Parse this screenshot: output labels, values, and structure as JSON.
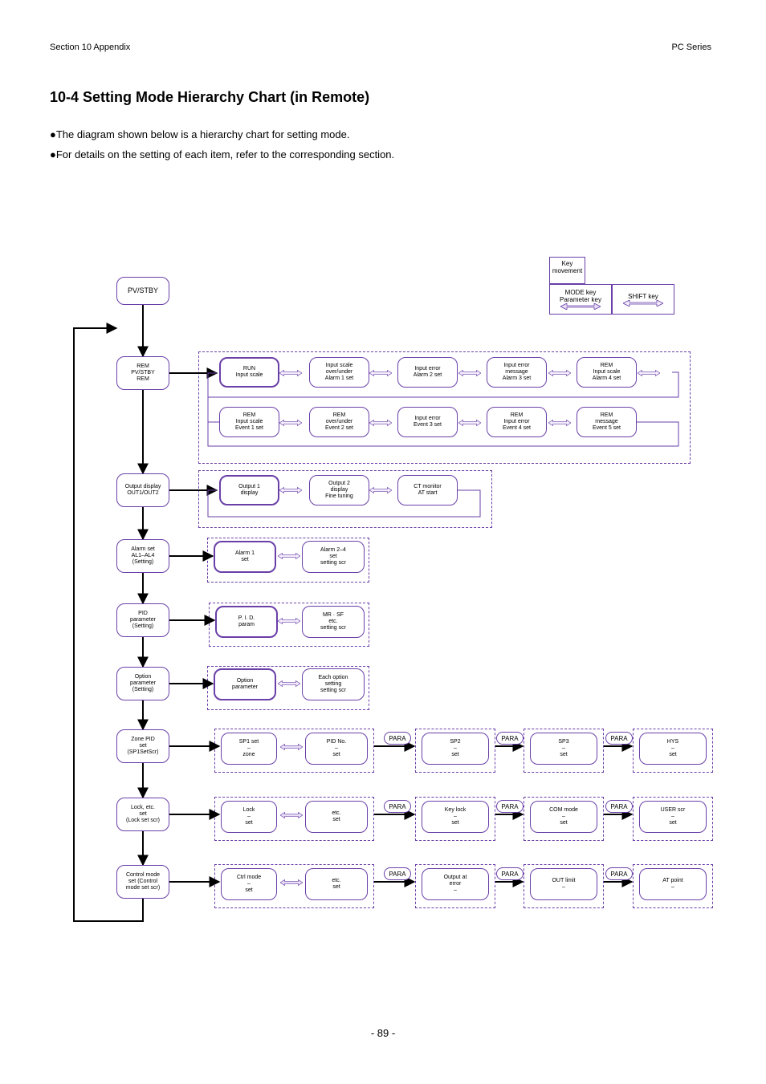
{
  "page_header": {
    "section": "Section 10 Appendix",
    "product": "PC Series"
  },
  "heading": {
    "main": "10-4 Setting Mode Hierarchy Chart (in Remote)",
    "note1": "●The diagram shown below is a hierarchy chart for setting mode.",
    "note2": "●For details on the setting of each item, refer to the corresponding section."
  },
  "footer": "- 89 -",
  "legend": {
    "title": "Key movement",
    "box1": "MODE key\nParameter key",
    "box2": "SHIFT key"
  },
  "main_column": {
    "root": {
      "l1": "PV/STBY",
      "l2": "",
      "l3": ""
    },
    "r1": {
      "l1": "REM",
      "l2": "PV/STBY",
      "l3": "REM"
    },
    "r2": {
      "l1": "Output display",
      "l2": "OUT1/OUT2",
      "l3": ""
    },
    "r3": {
      "l1": "Alarm set",
      "l2": "AL1–AL4",
      "l3": "(Setting)"
    },
    "r4": {
      "l1": "PID",
      "l2": "parameter",
      "l3": "(Setting)"
    },
    "r5": {
      "l1": "Option",
      "l2": "parameter",
      "l3": "(Setting)"
    },
    "r6": {
      "l1": "Zone PID",
      "l2": "set",
      "l3": "(SP1SetScr)"
    },
    "r7": {
      "l1": "Lock, etc.",
      "l2": "set",
      "l3": "(Lock set scr)"
    },
    "r8": {
      "l1": "Control mode",
      "l2": "set (Control",
      "l3": "mode set scr)"
    }
  },
  "rows": {
    "row1_top": [
      {
        "l1": "RUN",
        "l2": "Input scale",
        "l3": "",
        "bold": true
      },
      {
        "l1": "Input scale",
        "l2": "over/under",
        "l3": "Alarm 1 set",
        "bold": false
      },
      {
        "l1": "Input error",
        "l2": "",
        "l3": "Alarm 2 set",
        "bold": false
      },
      {
        "l1": "Input error",
        "l2": "message",
        "l3": "Alarm 3 set",
        "bold": false
      },
      {
        "l1": "REM",
        "l2": "Input scale",
        "l3": "Alarm 4 set",
        "bold": false
      }
    ],
    "row1_bot": [
      {
        "l1": "REM",
        "l2": "Input scale",
        "l3": "Event 1 set",
        "bold": false
      },
      {
        "l1": "REM",
        "l2": "over/under",
        "l3": "Event 2 set",
        "bold": false
      },
      {
        "l1": "Input error",
        "l2": "",
        "l3": "Event 3 set",
        "bold": false
      },
      {
        "l1": "REM",
        "l2": "Input error",
        "l3": "Event 4 set",
        "bold": false
      },
      {
        "l1": "REM",
        "l2": "message",
        "l3": "Event 5 set",
        "bold": false
      }
    ],
    "row2": [
      {
        "l1": "Output 1",
        "l2": "display",
        "l3": "",
        "bold": true
      },
      {
        "l1": "Output 2",
        "l2": "display",
        "l3": "Fine tuning",
        "bold": false
      },
      {
        "l1": "CT monitor",
        "l2": "",
        "l3": "AT start",
        "bold": false
      }
    ],
    "row3": [
      {
        "l1": "Alarm 1",
        "l2": "set",
        "l3": "",
        "bold": true
      },
      {
        "l1": "Alarm 2–4",
        "l2": "set",
        "l3": "setting scr",
        "bold": false
      }
    ],
    "row4": [
      {
        "l1": "P. I. D.",
        "l2": "param",
        "l3": "",
        "bold": true
      },
      {
        "l1": "MR · SF",
        "l2": "etc.",
        "l3": "setting scr",
        "bold": false
      }
    ],
    "row5": [
      {
        "l1": "Option",
        "l2": "parameter",
        "l3": "",
        "bold": true
      },
      {
        "l1": "Each option",
        "l2": "setting",
        "l3": "setting scr",
        "bold": false
      }
    ],
    "row6": {
      "pair": [
        {
          "l1": "SP1 set",
          "l2": "–",
          "l3": "zone"
        },
        {
          "l1": "PID No.",
          "l2": "–",
          "l3": "set"
        }
      ],
      "tail": [
        {
          "l1": "SP2",
          "l2": "–",
          "l3": "set"
        },
        {
          "l1": "SP3",
          "l2": "–",
          "l3": "set"
        },
        {
          "l1": "HYS",
          "l2": "–",
          "l3": "set"
        }
      ]
    },
    "row7": {
      "pair": [
        {
          "l1": "Lock",
          "l2": "–",
          "l3": "set"
        },
        {
          "l1": "etc.",
          "l2": "",
          "l3": "set"
        }
      ],
      "tail": [
        {
          "l1": "Key lock",
          "l2": "–",
          "l3": "set"
        },
        {
          "l1": "COM mode",
          "l2": "–",
          "l3": "set"
        },
        {
          "l1": "USER scr",
          "l2": "–",
          "l3": "set"
        }
      ]
    },
    "row8": {
      "pair": [
        {
          "l1": "Ctrl mode",
          "l2": "–",
          "l3": "set"
        },
        {
          "l1": "etc.",
          "l2": "",
          "l3": "set"
        }
      ],
      "tail": [
        {
          "l1": "Output at",
          "l2": "error",
          "l3": "–"
        },
        {
          "l1": "OUT limit",
          "l2": "",
          "l3": "–"
        },
        {
          "l1": "AT point",
          "l2": "",
          "l3": "–"
        }
      ]
    }
  },
  "pills": {
    "p": "PARA"
  },
  "colors": {
    "purple": "#6a3fa8"
  }
}
